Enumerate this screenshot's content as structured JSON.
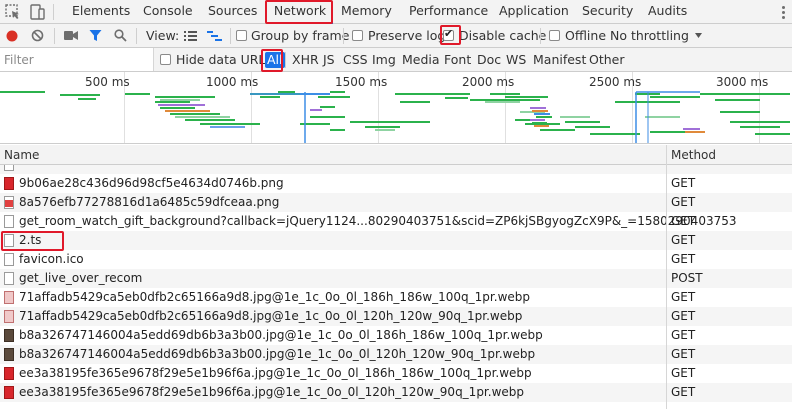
{
  "tabs": [
    {
      "label": "Elements"
    },
    {
      "label": "Console"
    },
    {
      "label": "Sources"
    },
    {
      "label": "Network"
    },
    {
      "label": "Memory"
    },
    {
      "label": "Performance"
    },
    {
      "label": "Application"
    },
    {
      "label": "Security"
    },
    {
      "label": "Audits"
    }
  ],
  "toolbar": {
    "view_label": "View:",
    "group_by_frame": "Group by frame",
    "preserve_log": "Preserve log",
    "disable_cache": "Disable cache",
    "disable_cache_checked": true,
    "offline": "Offline",
    "throttling": "No throttling"
  },
  "filter": {
    "placeholder": "Filter",
    "hide_data_urls": "Hide data URLs",
    "types": [
      "All",
      "XHR",
      "JS",
      "CSS",
      "Img",
      "Media",
      "Font",
      "Doc",
      "WS",
      "Manifest",
      "Other"
    ],
    "selected": "All"
  },
  "overview": {
    "ticks": [
      "500 ms",
      "1000 ms",
      "1500 ms",
      "2000 ms",
      "2500 ms",
      "3000 ms"
    ]
  },
  "table": {
    "columns": {
      "name": "Name",
      "method": "Method"
    },
    "rows": [
      {
        "name": "9b06ae28c436d96d98cf5e4634d0746b.png",
        "method": "GET",
        "icon": "red"
      },
      {
        "name": "8a576efb77278816d1a6485c59dfceaa.png",
        "method": "GET",
        "icon": "redstripe"
      },
      {
        "name": "get_room_watch_gift_background?callback=jQuery1124...80290403751&scid=ZP6kjSBgyogZcX9P&_=1580290403753",
        "method": "GET",
        "icon": "doc"
      },
      {
        "name": "2.ts",
        "method": "GET",
        "icon": "doc"
      },
      {
        "name": "favicon.ico",
        "method": "GET",
        "icon": "doc"
      },
      {
        "name": "get_live_over_recom",
        "method": "POST",
        "icon": "doc"
      },
      {
        "name": "71affadb5429ca5eb0dfb2c65166a9d8.jpg@1e_1c_0o_0l_186h_186w_100q_1pr.webp",
        "method": "GET",
        "icon": "pink"
      },
      {
        "name": "71affadb5429ca5eb0dfb2c65166a9d8.jpg@1e_1c_0o_0l_120h_120w_90q_1pr.webp",
        "method": "GET",
        "icon": "pink"
      },
      {
        "name": "b8a326747146004a5edd69db6b3a3b00.jpg@1e_1c_0o_0l_186h_186w_100q_1pr.webp",
        "method": "GET",
        "icon": "dark"
      },
      {
        "name": "b8a326747146004a5edd69db6b3a3b00.jpg@1e_1c_0o_0l_120h_120w_90q_1pr.webp",
        "method": "GET",
        "icon": "dark"
      },
      {
        "name": "ee3a38195fe365e9678f29e5e1b96f6a.jpg@1e_1c_0o_0l_186h_186w_100q_1pr.webp",
        "method": "GET",
        "icon": "red"
      },
      {
        "name": "ee3a38195fe365e9678f29e5e1b96f6a.jpg@1e_1c_0o_0l_120h_120w_90q_1pr.webp",
        "method": "GET",
        "icon": "red"
      }
    ]
  },
  "colors": {
    "accent": "#1a73e8",
    "record": "#d93025",
    "highlight_box": "#e0192a"
  }
}
